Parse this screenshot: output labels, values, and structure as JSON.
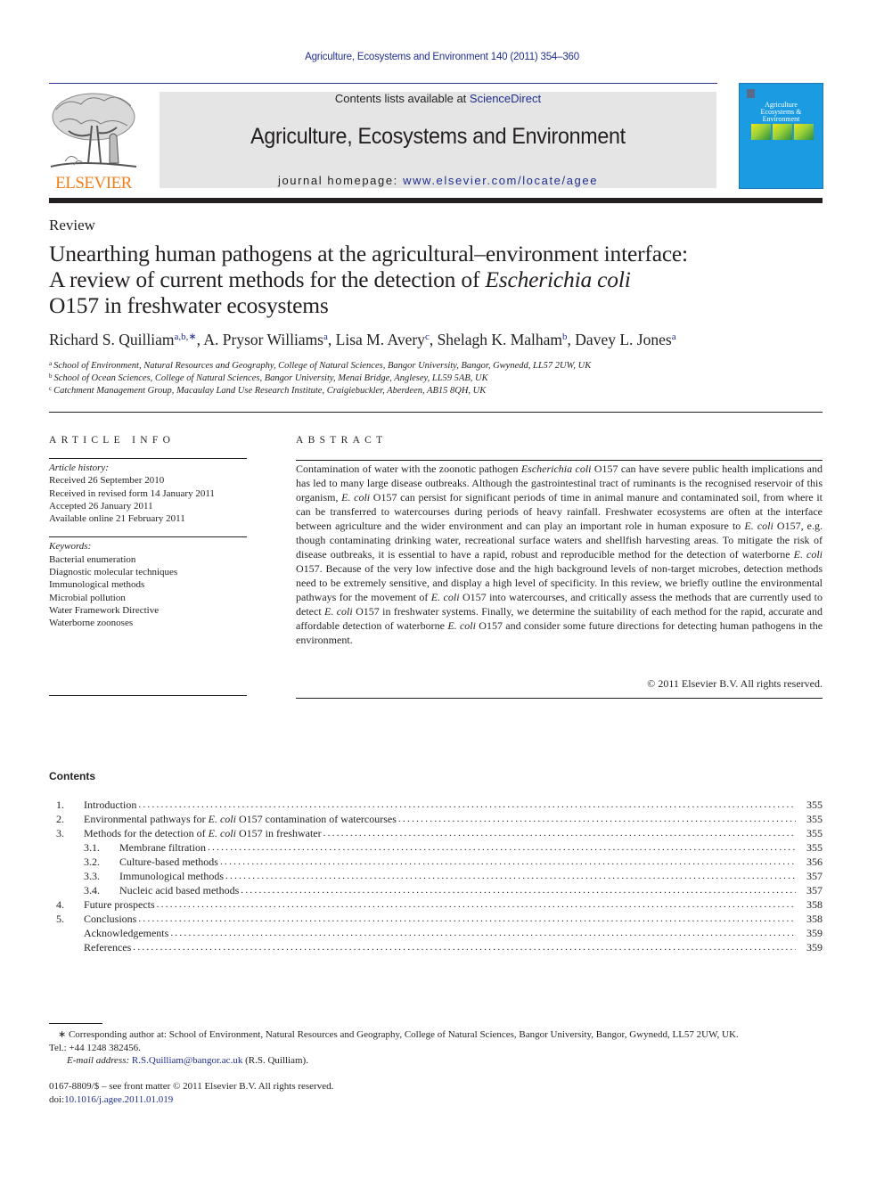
{
  "header": {
    "journal_ref": "Agriculture, Ecosystems and Environment 140 (2011) 354–360",
    "contents_available_prefix": "Contents lists available at ",
    "contents_available_link": "ScienceDirect",
    "journal_name": "Agriculture, Ecosystems and Environment",
    "homepage_prefix": "journal homepage: ",
    "homepage_url": "www.elsevier.com/locate/agee",
    "publisher_logo_text": "ELSEVIER",
    "cover_title_lines": [
      "Agriculture",
      "Ecosystems &",
      "Environment"
    ],
    "colors": {
      "link_blue": "#1f2e8f",
      "elsevier_orange": "#f07f1c",
      "cover_blue": "#1b9ce2",
      "banner_gray": "#e5e5e6"
    }
  },
  "article": {
    "section_type": "Review",
    "title_line1": "Unearthing human pathogens at the agricultural–environment interface:",
    "title_line2_prefix": "A review of current methods for the detection of ",
    "title_line2_italic": "Escherichia coli",
    "title_line3": "O157 in freshwater ecosystems",
    "authors": [
      {
        "name": "Richard S. Quilliam",
        "affil": "a,b,∗"
      },
      {
        "name": "A. Prysor Williams",
        "affil": "a"
      },
      {
        "name": "Lisa M. Avery",
        "affil": "c"
      },
      {
        "name": "Shelagh K. Malham",
        "affil": "b"
      },
      {
        "name": "Davey L. Jones",
        "affil": "a"
      }
    ],
    "affiliations": [
      {
        "key": "a",
        "text": "School of Environment, Natural Resources and Geography, College of Natural Sciences, Bangor University, Bangor, Gwynedd, LL57 2UW, UK"
      },
      {
        "key": "b",
        "text": "School of Ocean Sciences, College of Natural Sciences, Bangor University, Menai Bridge, Anglesey, LL59 5AB, UK"
      },
      {
        "key": "c",
        "text": "Catchment Management Group, Macaulay Land Use Research Institute, Craigiebuckler, Aberdeen, AB15 8QH, UK"
      }
    ]
  },
  "article_info": {
    "heading": "ARTICLE INFO",
    "history_label": "Article history:",
    "history": [
      "Received 26 September 2010",
      "Received in revised form 14 January 2011",
      "Accepted 26 January 2011",
      "Available online 21 February 2011"
    ],
    "keywords_label": "Keywords:",
    "keywords": [
      "Bacterial enumeration",
      "Diagnostic molecular techniques",
      "Immunological methods",
      "Microbial pollution",
      "Water Framework Directive",
      "Waterborne zoonoses"
    ]
  },
  "abstract": {
    "heading": "ABSTRACT",
    "segments": [
      {
        "t": "Contamination of water with the zoonotic pathogen "
      },
      {
        "t": "Escherichia coli",
        "i": true
      },
      {
        "t": " O157 can have severe public health implications and has led to many large disease outbreaks. Although the gastrointestinal tract of ruminants is the recognised reservoir of this organism, "
      },
      {
        "t": "E. coli",
        "i": true
      },
      {
        "t": " O157 can persist for significant periods of time in animal manure and contaminated soil, from where it can be transferred to watercourses during periods of heavy rainfall. Freshwater ecosystems are often at the interface between agriculture and the wider environment and can play an important role in human exposure to "
      },
      {
        "t": "E. coli",
        "i": true
      },
      {
        "t": " O157, e.g. though contaminating drinking water, recreational surface waters and shellfish harvesting areas. To mitigate the risk of disease outbreaks, it is essential to have a rapid, robust and reproducible method for the detection of waterborne "
      },
      {
        "t": "E. coli",
        "i": true
      },
      {
        "t": " O157. Because of the very low infective dose and the high background levels of non-target microbes, detection methods need to be extremely sensitive, and display a high level of specificity. In this review, we briefly outline the environmental pathways for the movement of "
      },
      {
        "t": "E. coli",
        "i": true
      },
      {
        "t": " O157 into watercourses, and critically assess the methods that are currently used to detect "
      },
      {
        "t": "E. coli",
        "i": true
      },
      {
        "t": " O157 in freshwater systems. Finally, we determine the suitability of each method for the rapid, accurate and affordable detection of waterborne "
      },
      {
        "t": "E. coli",
        "i": true
      },
      {
        "t": " O157 and consider some future directions for detecting human pathogens in the environment."
      }
    ],
    "copyright": "© 2011 Elsevier B.V. All rights reserved."
  },
  "contents": {
    "heading": "Contents",
    "items": [
      {
        "num": "1.",
        "level": 1,
        "title": [
          {
            "t": "Introduction"
          }
        ],
        "page": "355"
      },
      {
        "num": "2.",
        "level": 1,
        "title": [
          {
            "t": "Environmental pathways for "
          },
          {
            "t": "E. coli",
            "i": true
          },
          {
            "t": " O157 contamination of watercourses"
          }
        ],
        "page": "355"
      },
      {
        "num": "3.",
        "level": 1,
        "title": [
          {
            "t": "Methods for the detection of "
          },
          {
            "t": "E. coli",
            "i": true
          },
          {
            "t": " O157 in freshwater"
          }
        ],
        "page": "355"
      },
      {
        "num": "3.1.",
        "level": 2,
        "title": [
          {
            "t": "Membrane filtration"
          }
        ],
        "page": "355"
      },
      {
        "num": "3.2.",
        "level": 2,
        "title": [
          {
            "t": "Culture-based methods"
          }
        ],
        "page": "356"
      },
      {
        "num": "3.3.",
        "level": 2,
        "title": [
          {
            "t": "Immunological methods"
          }
        ],
        "page": "357"
      },
      {
        "num": "3.4.",
        "level": 2,
        "title": [
          {
            "t": "Nucleic acid based methods"
          }
        ],
        "page": "357"
      },
      {
        "num": "4.",
        "level": 1,
        "title": [
          {
            "t": "Future prospects"
          }
        ],
        "page": "358"
      },
      {
        "num": "5.",
        "level": 1,
        "title": [
          {
            "t": "Conclusions"
          }
        ],
        "page": "358"
      },
      {
        "num": "",
        "level": 1,
        "title": [
          {
            "t": "Acknowledgements"
          }
        ],
        "page": "359"
      },
      {
        "num": "",
        "level": 1,
        "title": [
          {
            "t": "References"
          }
        ],
        "page": "359"
      }
    ]
  },
  "footnotes": {
    "corresponding": "∗  Corresponding author at: School of Environment, Natural Resources and Geography, College of Natural Sciences, Bangor University, Bangor, Gwynedd, LL57 2UW, UK.",
    "tel": "Tel.: +44 1248 382456.",
    "email_label": "E-mail address: ",
    "email": "R.S.Quilliam@bangor.ac.uk",
    "email_suffix": " (R.S. Quilliam).",
    "front_matter": "0167-8809/$ – see front matter © 2011 Elsevier B.V. All rights reserved.",
    "doi_prefix": "doi:",
    "doi": "10.1016/j.agee.2011.01.019"
  }
}
